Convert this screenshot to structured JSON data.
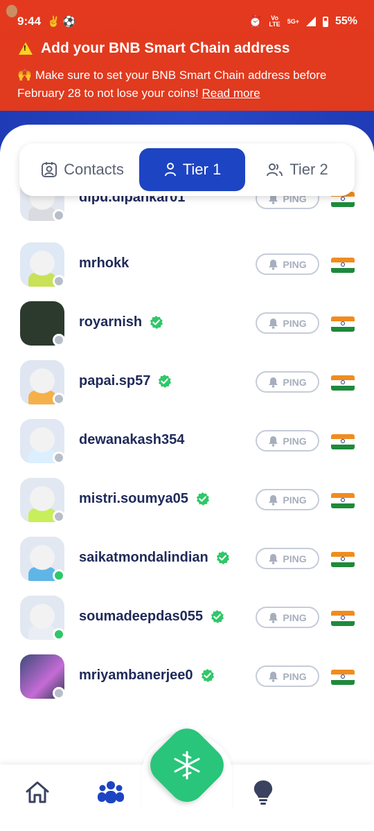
{
  "status_bar": {
    "time": "9:44",
    "network_label_top": "Vo",
    "network_label_bottom": "LTE",
    "network_type": "5G+",
    "battery": "55%"
  },
  "banner": {
    "title": "Add your BNB Smart Chain address",
    "emoji": "🙌",
    "message": "Make sure to set your BNB Smart Chain address before February 28 to not lose your coins!",
    "read_more": "Read more"
  },
  "tabs": [
    {
      "label": "Contacts",
      "active": false
    },
    {
      "label": "Tier 1",
      "active": true
    },
    {
      "label": "Tier 2",
      "active": false
    }
  ],
  "ping_label": "PING",
  "members": [
    {
      "username": "dipu.dipankar01",
      "verified": false,
      "online": false
    },
    {
      "username": "mrhokk",
      "verified": false,
      "online": false
    },
    {
      "username": "royarnish",
      "verified": true,
      "online": false
    },
    {
      "username": "papai.sp57",
      "verified": true,
      "online": false
    },
    {
      "username": "dewanakash354",
      "verified": false,
      "online": false
    },
    {
      "username": "mistri.soumya05",
      "verified": true,
      "online": false
    },
    {
      "username": "saikatmondalindian",
      "verified": true,
      "online": true
    },
    {
      "username": "soumadeepdas055",
      "verified": true,
      "online": true
    },
    {
      "username": "mriyambanerjee0",
      "verified": true,
      "online": false
    }
  ],
  "colors": {
    "banner_bg": "#e4391e",
    "accent_blue": "#1d44c2",
    "verified_green": "#2fc769",
    "center_button": "#28c57a"
  }
}
